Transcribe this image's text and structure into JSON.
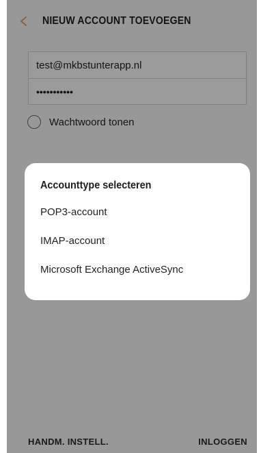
{
  "header": {
    "title": "NIEUW ACCOUNT TOEVOEGEN",
    "back_icon": "chevron-left-icon",
    "back_color": "#e58a6d"
  },
  "form": {
    "email_value": "test@mkbstunterapp.nl",
    "password_value": "•••••••••••",
    "show_password_label": "Wachtwoord tonen"
  },
  "footer": {
    "manual_label": "HANDM. INSTELL.",
    "login_label": "INLOGGEN"
  },
  "dialog": {
    "title": "Accounttype selecteren",
    "options": [
      "POP3-account",
      "IMAP-account",
      "Microsoft Exchange ActiveSync"
    ]
  }
}
